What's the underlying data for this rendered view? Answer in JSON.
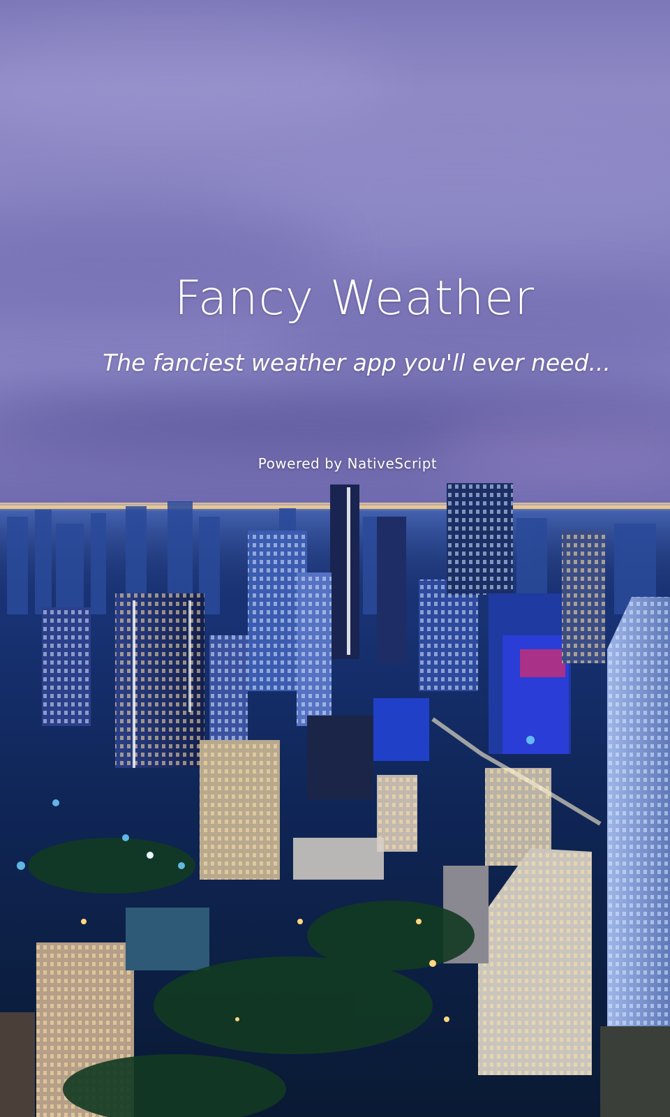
{
  "app": {
    "title": "Fancy Weather",
    "tagline": "The fanciest weather app you'll ever need...",
    "powered_by": "Powered by NativeScript"
  },
  "background": {
    "description_icon": "city-skyline-night-photo",
    "sky_color": "#7f7bbb",
    "city_glow": "#4fb3ff"
  }
}
